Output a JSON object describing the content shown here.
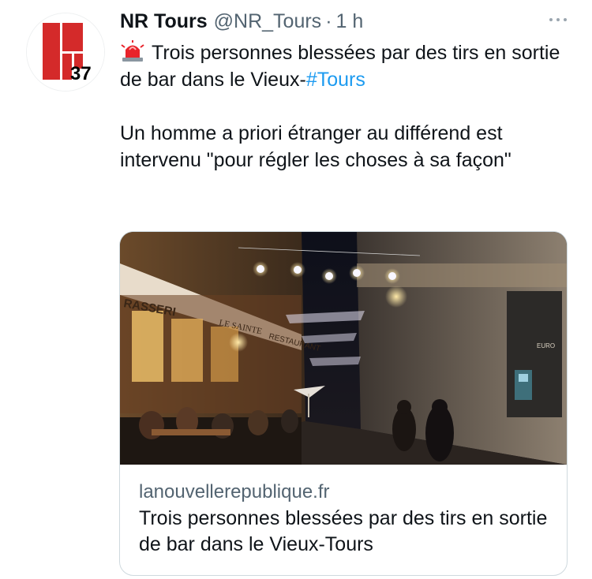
{
  "tweet": {
    "author_name": "NR Tours",
    "handle": "@NR_Tours",
    "separator": "·",
    "time": "1 h",
    "avatar_logo_text": "37",
    "line1": "Trois personnes blessées par des tirs en sortie de bar dans le Vieux-",
    "hashtag": "#Tours",
    "paragraph2": "Un homme a priori étranger au différend est intervenu \"pour régler les choses à sa façon\"",
    "emoji": "siren-emoji"
  },
  "card": {
    "domain": "lanouvellerepublique.fr",
    "title": "Trois personnes blessées par des tirs en sortie de bar dans le Vieux-Tours",
    "image_signs": [
      "RASSERI",
      "LE SAINTE",
      "RESTAURANT",
      "EURO"
    ]
  },
  "colors": {
    "text": "#0f1419",
    "secondary": "#536471",
    "link": "#1d9bf0",
    "logo_red": "#d42a2a",
    "border": "#cfd9de"
  }
}
